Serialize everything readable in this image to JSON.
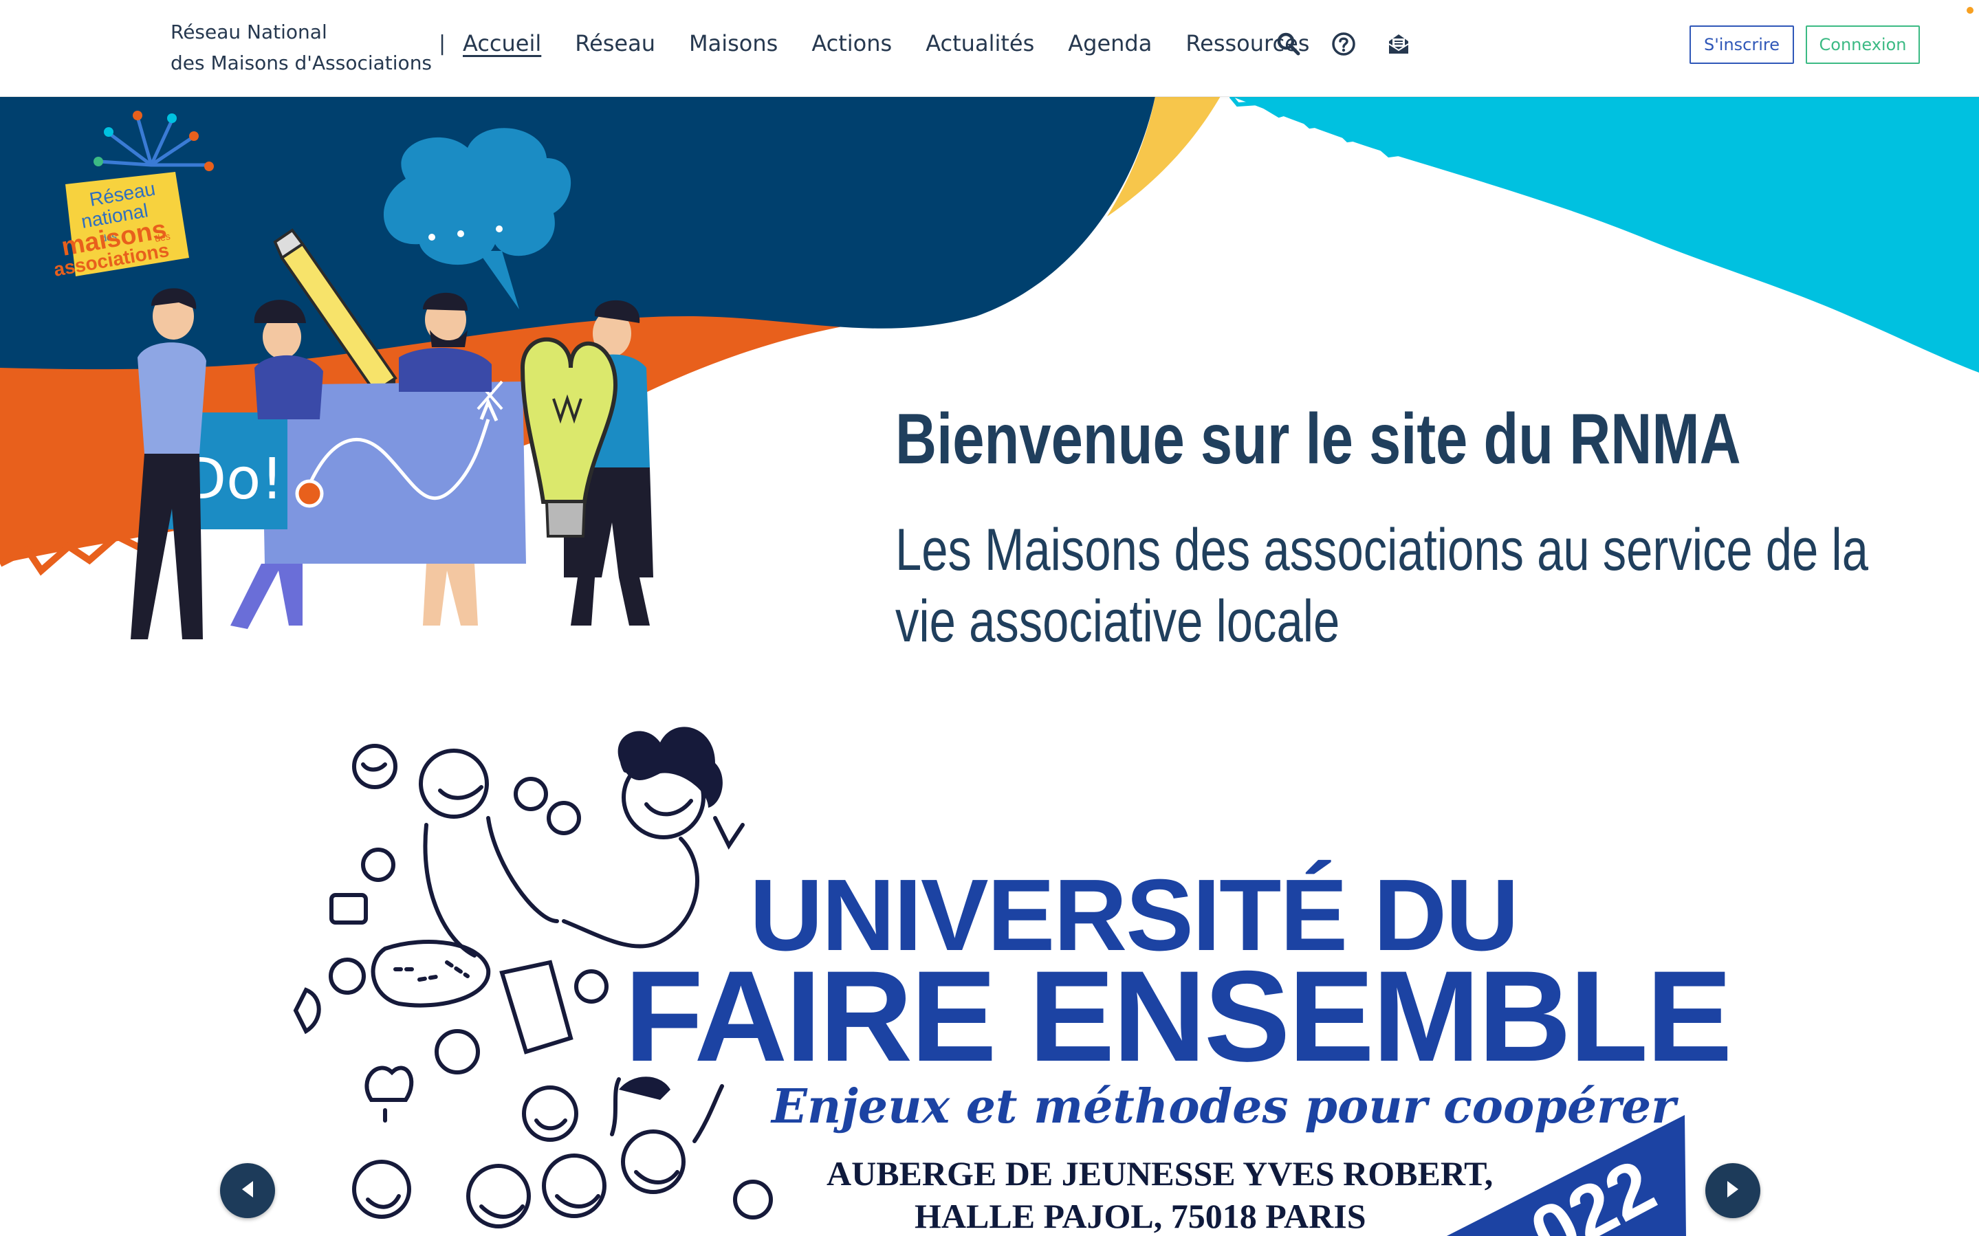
{
  "header": {
    "brand_line1": "Réseau National",
    "brand_line2": "des Maisons d'Associations",
    "separator": "|",
    "nav": [
      "Accueil",
      "Réseau",
      "Maisons",
      "Actions",
      "Actualités",
      "Agenda",
      "Ressources"
    ],
    "active_nav": "Accueil",
    "icons": [
      "search-icon",
      "help-icon",
      "newsletter-icon"
    ],
    "signup_label": "S'inscrire",
    "login_label": "Connexion",
    "colors": {
      "signup": "#2f57b8",
      "login": "#3cba84"
    }
  },
  "hero": {
    "logo": {
      "line1": "Réseau",
      "line2": "national",
      "line3": "maisons",
      "line4": "associations",
      "small1": "des",
      "small2": "des"
    },
    "sign_text": "Do!",
    "title": "Bienvenue sur le site du RNMA",
    "subtitle": "Les Maisons des associations au service de la vie associative locale",
    "colors": {
      "navy": "#00406e",
      "orange": "#e8601c",
      "cyan": "#00c1e0",
      "yellow": "#f7c64b",
      "title": "#203f5d"
    }
  },
  "carousel": {
    "slide": {
      "title_line1": "UNIVERSITÉ DU",
      "title_line2": "FAIRE ENSEMBLE",
      "subtitle": "Enjeux et méthodes pour coopérer",
      "location_line1": "AUBERGE DE JEUNESSE YVES ROBERT,",
      "location_line2": "HALLE PAJOL, 75018 PARIS",
      "year_partial": "022",
      "color": "#1c43a3"
    },
    "prev_icon": "chevron-left-icon",
    "next_icon": "chevron-right-icon"
  }
}
